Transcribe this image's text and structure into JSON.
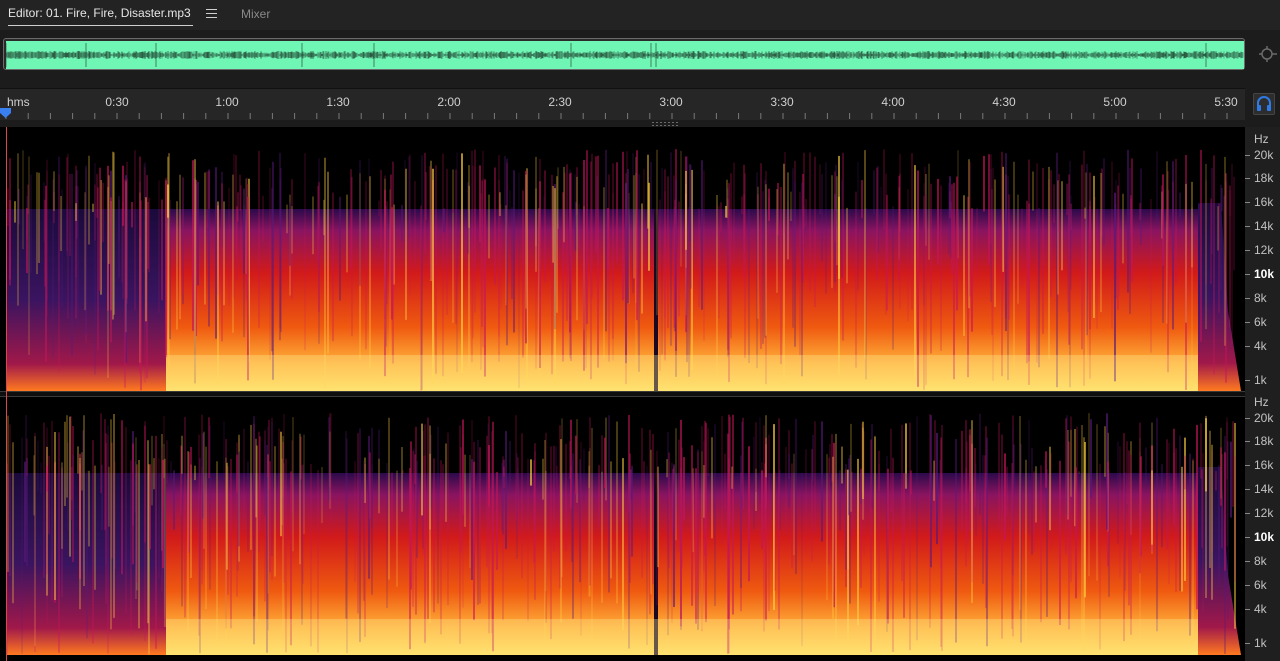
{
  "tabs": {
    "editor_label": "Editor: 01. Fire, Fire, Disaster.mp3",
    "mixer_label": "Mixer"
  },
  "icons": {
    "tab_menu": "hamburger-menu-icon",
    "zoom_navigator": "zoom-navigator-icon",
    "headphones": "headphones-icon",
    "playhead": "playhead-marker-icon"
  },
  "timeline": {
    "labels": [
      "hms",
      "0:30",
      "1:00",
      "1:30",
      "2:00",
      "2:30",
      "3:00",
      "3:30",
      "4:00",
      "4:30",
      "5:00",
      "5:30"
    ]
  },
  "frequency_axis": {
    "unit": "Hz",
    "labels": [
      "20k",
      "18k",
      "16k",
      "14k",
      "12k",
      "10k",
      "8k",
      "6k",
      "4k",
      "1k"
    ],
    "bold_label": "10k"
  },
  "colors": {
    "waveform": "#6ff5b4",
    "playhead": "#3a7ff0",
    "spectrogram_low": "#2a0a4a",
    "spectrogram_mid": "#d11a1a",
    "spectrogram_high": "#ffe060",
    "accent_blue": "#2e7be5"
  }
}
